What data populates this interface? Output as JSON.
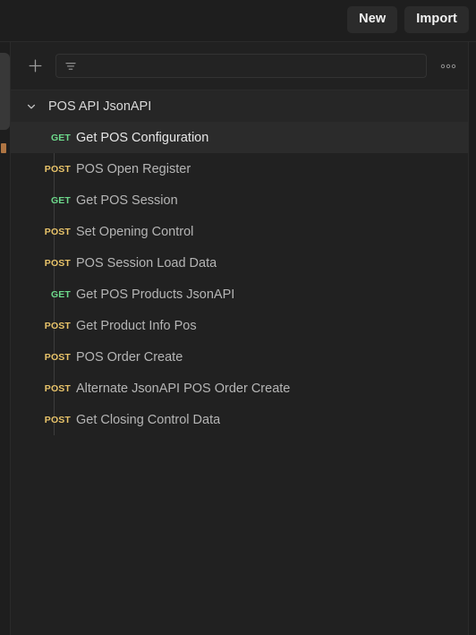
{
  "topbar": {
    "new_label": "New",
    "import_label": "Import"
  },
  "sidebar_toolbar": {
    "new_icon": "plus-icon",
    "filter_icon": "filter-icon",
    "filter_placeholder": "",
    "filter_value": "",
    "more_icon": "more-horizontal-icon"
  },
  "collection": {
    "name": "POS API JsonAPI",
    "expanded": true,
    "chevron_icon": "chevron-down-icon",
    "requests": [
      {
        "method": "GET",
        "name": "Get POS Configuration",
        "active": true
      },
      {
        "method": "POST",
        "name": "POS Open Register",
        "active": false
      },
      {
        "method": "GET",
        "name": "Get POS Session",
        "active": false
      },
      {
        "method": "POST",
        "name": "Set Opening Control",
        "active": false
      },
      {
        "method": "POST",
        "name": "POS Session Load Data",
        "active": false
      },
      {
        "method": "GET",
        "name": "Get POS Products JsonAPI",
        "active": false
      },
      {
        "method": "POST",
        "name": "Get Product Info Pos",
        "active": false
      },
      {
        "method": "POST",
        "name": "POS Order Create",
        "active": false
      },
      {
        "method": "POST",
        "name": "Alternate JsonAPI POS Order Create",
        "active": false
      },
      {
        "method": "POST",
        "name": "Get Closing Control Data",
        "active": false
      }
    ]
  },
  "colors": {
    "background": "#1e1e1e",
    "sidebar_background": "#212121",
    "row_active": "#2b2b2b",
    "collection_header": "#262626",
    "method_get": "#6dd98b",
    "method_post": "#e9c46a",
    "text_primary": "#e6e6e6",
    "text_secondary": "#b5b5b5",
    "divider": "#2b2b2b"
  }
}
